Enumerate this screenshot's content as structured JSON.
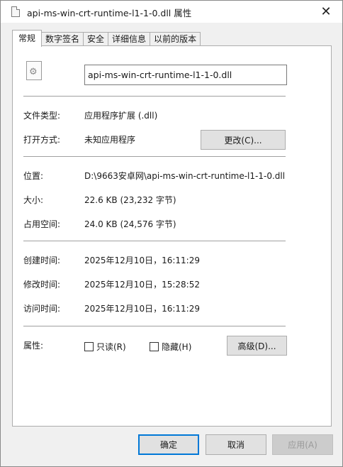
{
  "window": {
    "title": "api-ms-win-crt-runtime-l1-1-0.dll 属性",
    "close_glyph": "✕"
  },
  "tabs": [
    {
      "label": "常规",
      "active": true
    },
    {
      "label": "数字签名",
      "active": false
    },
    {
      "label": "安全",
      "active": false
    },
    {
      "label": "详细信息",
      "active": false
    },
    {
      "label": "以前的版本",
      "active": false
    }
  ],
  "general": {
    "file_icon": "dll-file-gear-icon",
    "file_name": "api-ms-win-crt-runtime-l1-1-0.dll",
    "type_label": "文件类型:",
    "type_value": "应用程序扩展 (.dll)",
    "opens_label": "打开方式:",
    "opens_value": "未知应用程序",
    "change_button": "更改(C)...",
    "location_label": "位置:",
    "location_value": "D:\\9663安卓网\\api-ms-win-crt-runtime-l1-1-0.dll",
    "size_label": "大小:",
    "size_value": "22.6 KB (23,232 字节)",
    "size_on_disk_label": "占用空间:",
    "size_on_disk_value": "24.0 KB (24,576 字节)",
    "created_label": "创建时间:",
    "created_value": "2025年12月10日，16:11:29",
    "modified_label": "修改时间:",
    "modified_value": "2025年12月10日，15:28:52",
    "accessed_label": "访问时间:",
    "accessed_value": "2025年12月10日，16:11:29",
    "attributes_label": "属性:",
    "readonly_label": "只读(R)",
    "readonly_checked": false,
    "hidden_label": "隐藏(H)",
    "hidden_checked": false,
    "advanced_button": "高级(D)..."
  },
  "footer": {
    "ok": "确定",
    "cancel": "取消",
    "apply": "应用(A)"
  }
}
